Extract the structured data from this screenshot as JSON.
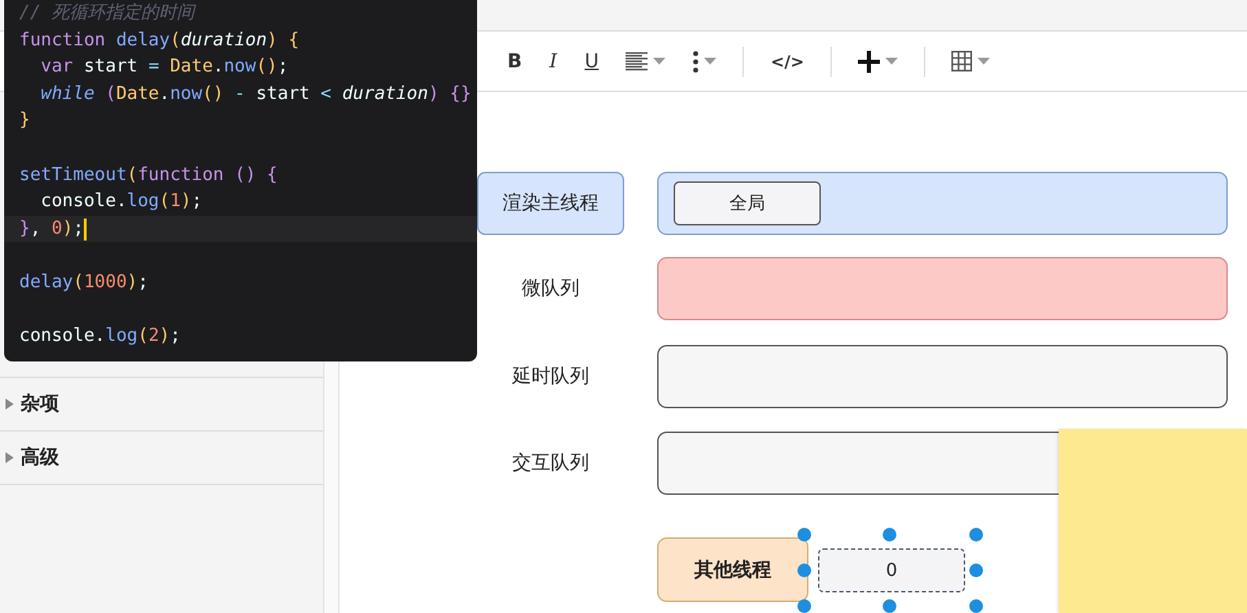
{
  "code_panel": {
    "lines": [
      {
        "kind": "code",
        "current": false,
        "tokens": [
          {
            "kind": "comment",
            "text": "// 死循环指定的时间"
          }
        ]
      },
      {
        "kind": "code",
        "current": false,
        "tokens": [
          {
            "kind": "keyword",
            "text": "function "
          },
          {
            "kind": "fn",
            "text": "delay"
          },
          {
            "kind": "bracket",
            "text": "("
          },
          {
            "kind": "param",
            "text": "duration"
          },
          {
            "kind": "bracket",
            "text": ")"
          },
          {
            "kind": "bracket",
            "text": " {"
          }
        ]
      },
      {
        "kind": "code",
        "current": false,
        "tokens": [
          {
            "kind": "keyword",
            "text": "  var"
          },
          {
            "kind": "plain",
            "text": " start "
          },
          {
            "kind": "op",
            "text": "="
          },
          {
            "kind": "class",
            "text": " Date"
          },
          {
            "kind": "plain",
            "text": "."
          },
          {
            "kind": "fn",
            "text": "now"
          },
          {
            "kind": "bracket",
            "text": "()"
          },
          {
            "kind": "plain",
            "text": ";"
          }
        ]
      },
      {
        "kind": "code",
        "current": false,
        "tokens": [
          {
            "kind": "keyword-italic",
            "text": "  while"
          },
          {
            "kind": "bracket-alt",
            "text": " ("
          },
          {
            "kind": "class",
            "text": "Date"
          },
          {
            "kind": "plain",
            "text": "."
          },
          {
            "kind": "fn",
            "text": "now"
          },
          {
            "kind": "bracket",
            "text": "()"
          },
          {
            "kind": "op",
            "text": " - "
          },
          {
            "kind": "plain",
            "text": "start"
          },
          {
            "kind": "op",
            "text": " < "
          },
          {
            "kind": "param",
            "text": "duration"
          },
          {
            "kind": "bracket-alt",
            "text": ")"
          },
          {
            "kind": "bracket-alt",
            "text": " {}"
          }
        ]
      },
      {
        "kind": "code",
        "current": false,
        "tokens": [
          {
            "kind": "bracket",
            "text": "}"
          }
        ]
      },
      {
        "kind": "blank"
      },
      {
        "kind": "code",
        "current": false,
        "tokens": [
          {
            "kind": "fn",
            "text": "setTimeout"
          },
          {
            "kind": "bracket",
            "text": "("
          },
          {
            "kind": "keyword",
            "text": "function "
          },
          {
            "kind": "bracket-alt",
            "text": "()"
          },
          {
            "kind": "bracket-alt",
            "text": " {"
          }
        ]
      },
      {
        "kind": "code",
        "current": false,
        "tokens": [
          {
            "kind": "plain",
            "text": "  console."
          },
          {
            "kind": "fn",
            "text": "log"
          },
          {
            "kind": "bracket",
            "text": "("
          },
          {
            "kind": "num",
            "text": "1"
          },
          {
            "kind": "bracket",
            "text": ")"
          },
          {
            "kind": "plain",
            "text": ";"
          }
        ]
      },
      {
        "kind": "code",
        "current": true,
        "tokens": [
          {
            "kind": "bracket-alt",
            "text": "}"
          },
          {
            "kind": "plain",
            "text": ", "
          },
          {
            "kind": "num",
            "text": "0"
          },
          {
            "kind": "bracket",
            "text": ")"
          },
          {
            "kind": "plain",
            "text": ";"
          }
        ]
      },
      {
        "kind": "blank"
      },
      {
        "kind": "code",
        "current": false,
        "tokens": [
          {
            "kind": "fn",
            "text": "delay"
          },
          {
            "kind": "bracket",
            "text": "("
          },
          {
            "kind": "num",
            "text": "1000"
          },
          {
            "kind": "bracket",
            "text": ")"
          },
          {
            "kind": "plain",
            "text": ";"
          }
        ]
      },
      {
        "kind": "blank"
      },
      {
        "kind": "code",
        "current": false,
        "tokens": [
          {
            "kind": "plain",
            "text": "console."
          },
          {
            "kind": "fn",
            "text": "log"
          },
          {
            "kind": "bracket",
            "text": "("
          },
          {
            "kind": "num",
            "text": "2"
          },
          {
            "kind": "bracket",
            "text": ")"
          },
          {
            "kind": "plain",
            "text": ";"
          }
        ]
      }
    ]
  },
  "toolbar": {
    "items": [
      {
        "kind": "text",
        "label": "B",
        "dropdown": false
      },
      {
        "kind": "text",
        "label": "I",
        "dropdown": false
      },
      {
        "kind": "text",
        "label": "U",
        "dropdown": false
      },
      {
        "kind": "align",
        "dropdown": true
      },
      {
        "kind": "more",
        "dropdown": true
      },
      {
        "kind": "separator"
      },
      {
        "kind": "text",
        "label": "</>",
        "dropdown": false
      },
      {
        "kind": "separator"
      },
      {
        "kind": "plus",
        "dropdown": true
      },
      {
        "kind": "separator"
      },
      {
        "kind": "table",
        "dropdown": true
      }
    ]
  },
  "sidebar": {
    "items": [
      {
        "label": "杂项",
        "expanded": false
      },
      {
        "label": "高级",
        "expanded": false
      }
    ]
  },
  "diagram": {
    "lanes": [
      {
        "label": "渲染主线程",
        "label_boxed": true,
        "color": "#d6e4fc",
        "tasks": [
          {
            "label": "全局",
            "selected": false
          }
        ]
      },
      {
        "label": "微队列",
        "label_boxed": false,
        "color": "#fcc9c7"
      },
      {
        "label": "延时队列",
        "label_boxed": false,
        "color": "#f6f6f6"
      },
      {
        "label": "交互队列",
        "label_boxed": false,
        "color": "#f6f6f6"
      }
    ],
    "other_thread": {
      "label": "其他线程",
      "tasks": [
        {
          "label": "0",
          "selected": true
        }
      ]
    }
  }
}
